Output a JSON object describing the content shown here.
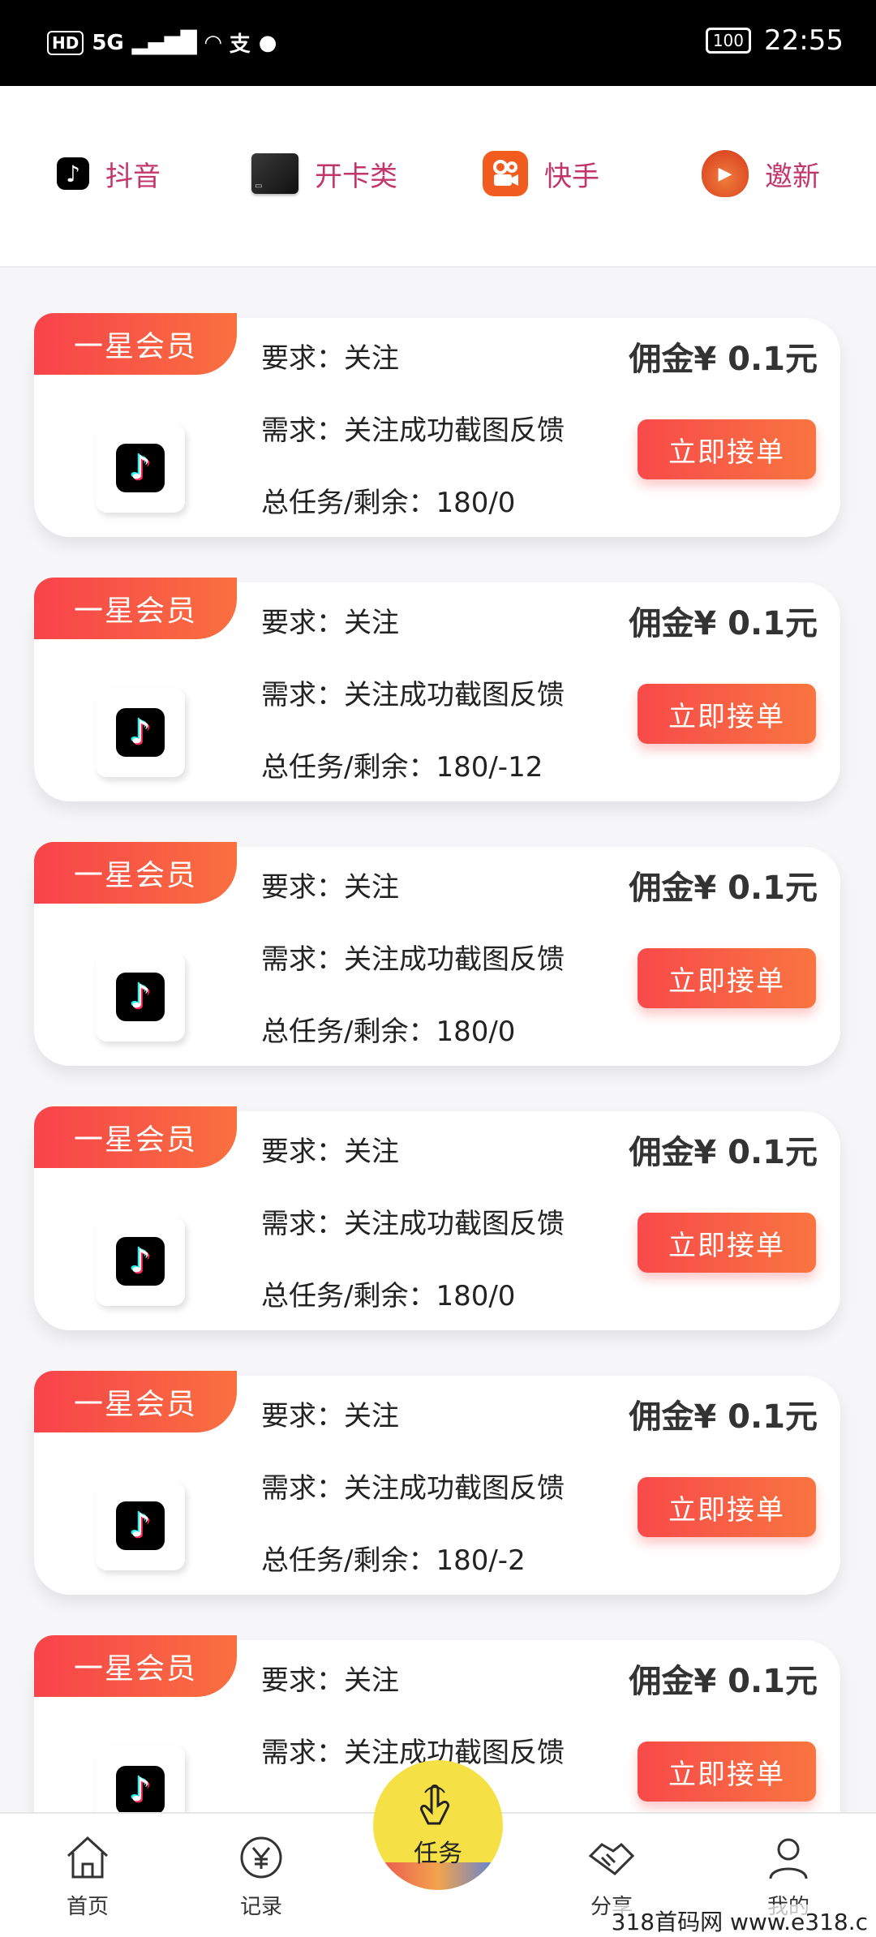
{
  "status": {
    "hd": "HD",
    "network": "5G",
    "time": "22:55",
    "battery": "100"
  },
  "categories": [
    {
      "label": "抖音",
      "icon": "tiktok-icon"
    },
    {
      "label": "开卡类",
      "icon": "bank-card-icon"
    },
    {
      "label": "快手",
      "icon": "kuaishou-icon"
    },
    {
      "label": "邀新",
      "icon": "red-bag-icon"
    }
  ],
  "tasks": [
    {
      "badge": "一星会员",
      "requirement": "要求：关注",
      "need": "需求：关注成功截图反馈",
      "total": "总任务/剩余：180/0",
      "commission": "佣金¥ 0.1元",
      "button": "立即接单"
    },
    {
      "badge": "一星会员",
      "requirement": "要求：关注",
      "need": "需求：关注成功截图反馈",
      "total": "总任务/剩余：180/-12",
      "commission": "佣金¥ 0.1元",
      "button": "立即接单"
    },
    {
      "badge": "一星会员",
      "requirement": "要求：关注",
      "need": "需求：关注成功截图反馈",
      "total": "总任务/剩余：180/0",
      "commission": "佣金¥ 0.1元",
      "button": "立即接单"
    },
    {
      "badge": "一星会员",
      "requirement": "要求：关注",
      "need": "需求：关注成功截图反馈",
      "total": "总任务/剩余：180/0",
      "commission": "佣金¥ 0.1元",
      "button": "立即接单"
    },
    {
      "badge": "一星会员",
      "requirement": "要求：关注",
      "need": "需求：关注成功截图反馈",
      "total": "总任务/剩余：180/-2",
      "commission": "佣金¥ 0.1元",
      "button": "立即接单"
    },
    {
      "badge": "一星会员",
      "requirement": "要求：关注",
      "need": "需求：关注成功截图反馈",
      "total": "",
      "commission": "佣金¥ 0.1元",
      "button": "立即接单"
    }
  ],
  "nav": {
    "home": "首页",
    "records": "记录",
    "task": "任务",
    "share": "分享",
    "mine": "我的"
  },
  "watermark": "318首码网 www.e318.c"
}
